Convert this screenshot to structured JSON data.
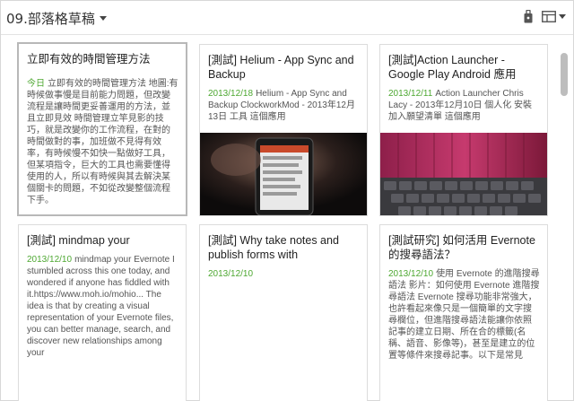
{
  "header": {
    "notebook_title": "09.部落格草稿"
  },
  "notes": [
    {
      "title": "立即有效的時間管理方法",
      "date": "今日",
      "snippet": "立即有效的時間管理方法 地圖:有時候做事慢是目前能力問題，但改變流程是讓時間更妥善運用的方法，並且立即見效 時間管理立竿見影的技巧，就是改變你的工作流程，在對的時間做對的事，加班做不見得有效率，有時候慢不如快一點做好工具，但某項指令，巨大的工具也需要懂得使用的人，所以有時候與其去解決某個關卡的問題，不如從改變整個流程下手。"
    },
    {
      "title": "[測試] Helium - App Sync and Backup",
      "date": "2013/12/18",
      "snippet": "Helium - App Sync and Backup ClockworkMod - 2013年12月13日 工具 這個應用"
    },
    {
      "title": "[測試]Action Launcher - Google Play Android 應用",
      "date": "2013/12/11",
      "snippet": "Action Launcher Chris Lacy - 2013年12月10日 個人化 安裝 加入願望清單 這個應用"
    },
    {
      "title": "[測試] mindmap your",
      "date": "2013/12/10",
      "snippet": "mindmap your Evernote I stumbled across this one today, and wondered if anyone has fiddled with it.https://www.moh.io/mohio... The idea is that by creating a visual representation of your Evernote files, you can better manage, search, and discover new relationships among your"
    },
    {
      "title": "[測試] Why take notes and publish forms with",
      "date": "2013/12/10",
      "snippet": ""
    },
    {
      "title": "[測試研究] 如何活用 Evernote 的搜尋語法？",
      "date": "2013/12/10",
      "snippet": "使用 Evernote 的進階搜尋語法 影片：如何使用 Evernote 進階搜尋語法 Evernote 搜尋功能非常強大，也許看起來像只是一個簡單的文字搜尋欄位，但進階搜尋語法能讓你依照記事的建立日期、所在合的標籤(名稱、語音、影像等)，甚至是建立的位置等條件來搜尋記事。以下是常見"
    }
  ],
  "colors": {
    "date_green": "#4ea832",
    "card_border": "#dcdcdc",
    "selected_border": "#b8b8b8"
  },
  "icons": {
    "reminder": "reminder-icon",
    "view": "card-view-icon"
  }
}
